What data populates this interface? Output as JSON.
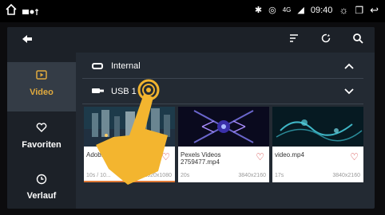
{
  "status": {
    "left_icons": [
      "home-icon",
      "notification-icons"
    ],
    "right_icons": [
      "bluetooth-icon",
      "location-icon",
      "signal-icon"
    ],
    "network": "4G",
    "time": "09:40"
  },
  "toolbar": {
    "icons": [
      "back-arrow-icon",
      "sort-icon",
      "refresh-icon",
      "search-icon"
    ]
  },
  "sidebar": {
    "items": [
      {
        "label": "Video",
        "icon": "video-icon",
        "active": true
      },
      {
        "label": "Favoriten",
        "icon": "heart-icon",
        "active": false
      },
      {
        "label": "Verlauf",
        "icon": "clock-icon",
        "active": false
      }
    ]
  },
  "sources": [
    {
      "label": "Internal",
      "icon": "drive-icon",
      "chevron": "up"
    },
    {
      "label": "USB 1",
      "icon": "usb-icon",
      "chevron": "down"
    }
  ],
  "videos": [
    {
      "title": "Adob... 37.m...",
      "duration": "10s / 10...",
      "resolution": "1920x1080",
      "favorite": true,
      "progress": 1.0
    },
    {
      "title": "Pexels Videos 2759477.mp4",
      "duration": "20s",
      "resolution": "3840x2160",
      "favorite": true,
      "progress": 0
    },
    {
      "title": "video.mp4",
      "duration": "17s",
      "resolution": "3840x2160",
      "favorite": true,
      "progress": 0
    }
  ],
  "colors": {
    "accent": "#e0aa3e",
    "favorite": "#d23b3b",
    "panel": "#232a33"
  }
}
